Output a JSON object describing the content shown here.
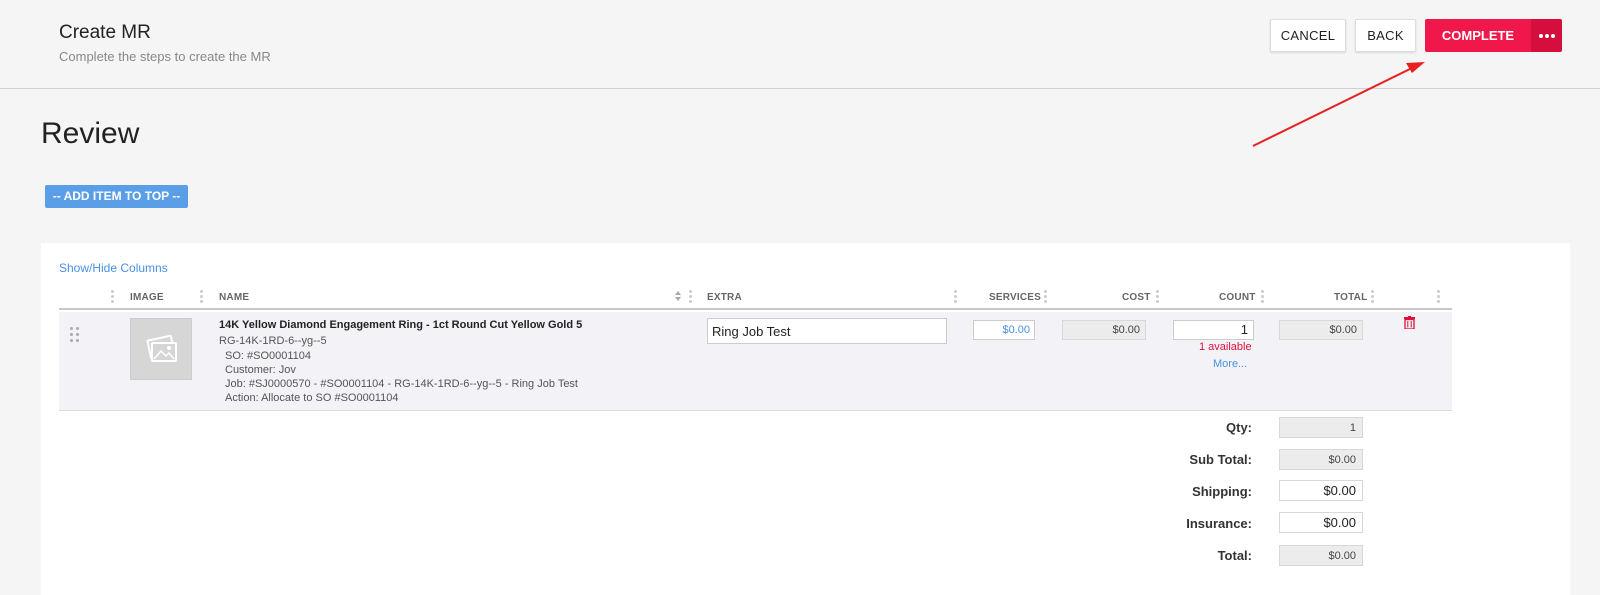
{
  "header": {
    "title": "Create MR",
    "subtitle": "Complete the steps to create the MR",
    "cancel_label": "CANCEL",
    "back_label": "BACK",
    "complete_label": "COMPLETE"
  },
  "page": {
    "title": "Review",
    "add_item_label": "-- ADD ITEM TO TOP --",
    "show_hide_label": "Show/Hide Columns"
  },
  "table": {
    "columns": [
      "IMAGE",
      "NAME",
      "EXTRA",
      "SERVICES",
      "COST",
      "COUNT",
      "TOTAL"
    ],
    "rows": [
      {
        "name": "14K Yellow Diamond Engagement Ring - 1ct Round Cut Yellow Gold 5",
        "sku": "RG-14K-1RD-6--yg--5",
        "so": "SO: #SO0001104",
        "customer": "Customer: Jov",
        "job": "Job: #SJ0000570 - #SO0001104 - RG-14K-1RD-6--yg--5 - Ring Job Test",
        "action": "Action: Allocate to SO #SO0001104",
        "extra": "Ring Job Test",
        "services": "$0.00",
        "cost": "$0.00",
        "count": "1",
        "available": "1 available",
        "more": "More...",
        "total": "$0.00"
      }
    ]
  },
  "summary": {
    "qty_label": "Qty:",
    "qty": "1",
    "subtotal_label": "Sub Total:",
    "subtotal": "$0.00",
    "shipping_label": "Shipping:",
    "shipping": "$0.00",
    "insurance_label": "Insurance:",
    "insurance": "$0.00",
    "total_label": "Total:",
    "total": "$0.00"
  },
  "colors": {
    "accent": "#f0174a",
    "link": "#4a90e2",
    "arrow": "#e82020"
  }
}
